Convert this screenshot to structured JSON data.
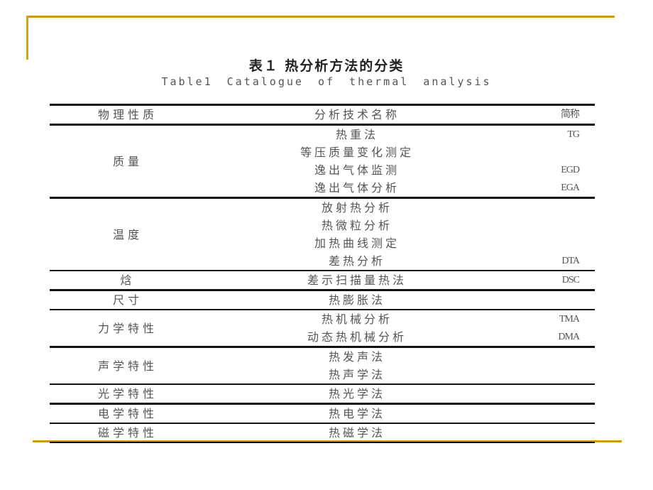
{
  "title_cn": "表１ 热分析方法的分类",
  "title_en": "Table1 Catalogue of thermal analysis",
  "accent_color": "#d29a0a",
  "table": {
    "headers": [
      "物理性质",
      "分析技术名称",
      "简称"
    ],
    "groups": [
      {
        "property": "质量",
        "rows": [
          {
            "name": "热重法",
            "abbr": "TG"
          },
          {
            "name": "等压质量变化测定",
            "abbr": ""
          },
          {
            "name": "逸出气体监测",
            "abbr": "EGD"
          },
          {
            "name": "逸出气体分析",
            "abbr": "EGA"
          }
        ]
      },
      {
        "property": "温度",
        "rows": [
          {
            "name": "放射热分析",
            "abbr": ""
          },
          {
            "name": "热微粒分析",
            "abbr": ""
          },
          {
            "name": "加热曲线测定",
            "abbr": ""
          },
          {
            "name": "差热分析",
            "abbr": "DTA"
          }
        ]
      },
      {
        "property": "焓",
        "rows": [
          {
            "name": "差示扫描量热法",
            "abbr": "DSC"
          }
        ]
      },
      {
        "property": "尺寸",
        "rows": [
          {
            "name": "热膨胀法",
            "abbr": ""
          }
        ]
      },
      {
        "property": "力学特性",
        "rows": [
          {
            "name": "热机械分析",
            "abbr": "TMA"
          },
          {
            "name": "动态热机械分析",
            "abbr": "DMA"
          }
        ]
      },
      {
        "property": "声学特性",
        "rows": [
          {
            "name": "热发声法",
            "abbr": ""
          },
          {
            "name": "热声学法",
            "abbr": ""
          }
        ]
      },
      {
        "property": "光学特性",
        "rows": [
          {
            "name": "热光学法",
            "abbr": ""
          }
        ]
      },
      {
        "property": "电学特性",
        "rows": [
          {
            "name": "热电学法",
            "abbr": ""
          }
        ]
      },
      {
        "property": "磁学特性",
        "rows": [
          {
            "name": "热磁学法",
            "abbr": ""
          }
        ]
      }
    ]
  }
}
